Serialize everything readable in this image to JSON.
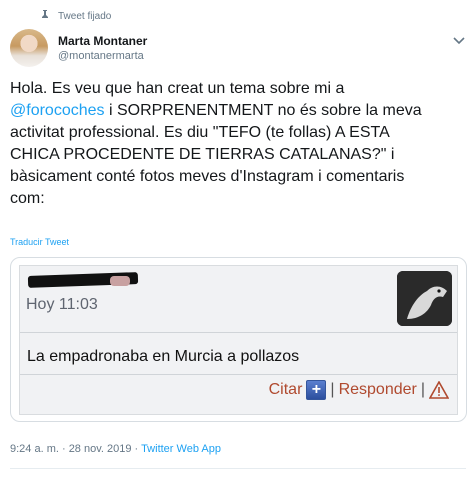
{
  "pinned_label": "Tweet fijado",
  "author": {
    "name": "Marta Montaner",
    "handle": "@montanermarta"
  },
  "tweet": {
    "text_before": "Hola. Es veu que han creat un tema sobre mi a\n",
    "mention": "@forocoches",
    "text_after": " i SORPRENENTMENT no és sobre la meva\nactivitat professional. Es diu \"TEFO (te follas) A ESTA\nCHICA PROCEDENTE DE TIERRAS CATALANAS?\" i\nbàsicament conté fotos meves d'Instagram i comentaris\ncom:"
  },
  "translate_label": "Traducir Tweet",
  "embedded_post": {
    "time": "Hoy 11:03",
    "text": "La empadronaba en Murcia a pollazos",
    "quote_label": "Citar",
    "quote_icon_glyph": "+",
    "separator": "|",
    "reply_label": "Responder"
  },
  "meta": {
    "timestamp": "9:24 a. m. · 28 nov. 2019 · ",
    "app": "Twitter Web App"
  },
  "colors": {
    "link": "#1da1f2",
    "forum_action": "#b04a2f"
  },
  "icons": [
    "pin-icon",
    "chevron-down-icon",
    "quote-plus-icon",
    "warning-triangle-icon"
  ]
}
